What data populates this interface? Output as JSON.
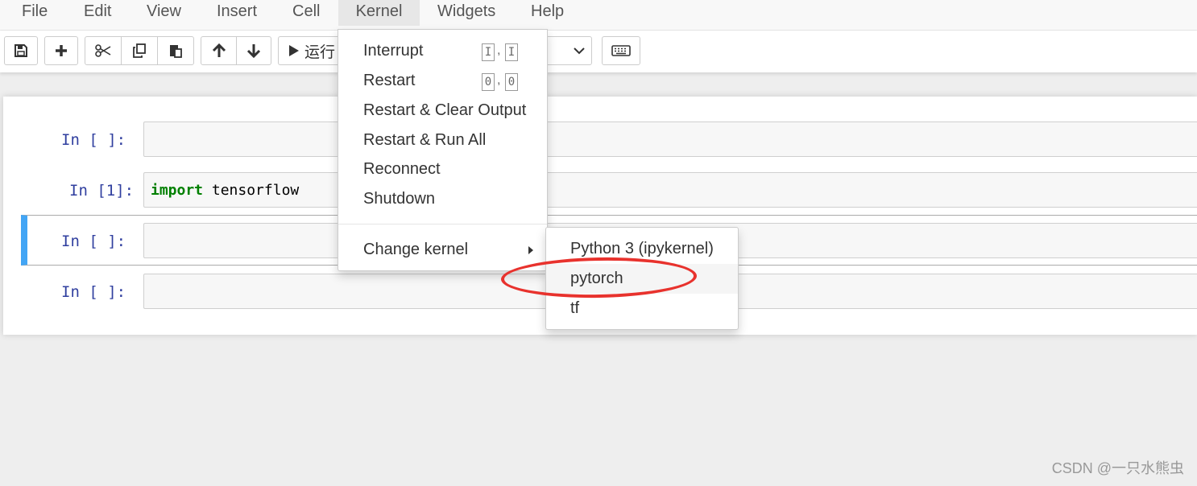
{
  "menubar": {
    "items": [
      "File",
      "Edit",
      "View",
      "Insert",
      "Cell",
      "Kernel",
      "Widgets",
      "Help"
    ],
    "active": "Kernel"
  },
  "toolbar": {
    "run_label": "运行",
    "icons": [
      "save-icon",
      "plus-icon",
      "scissors-icon",
      "copy-icon",
      "paste-icon",
      "arrow-up-icon",
      "arrow-down-icon",
      "play-icon",
      "keyboard-icon"
    ]
  },
  "cells": [
    {
      "prompt": "In [ ]:",
      "code": ""
    },
    {
      "prompt": "In [1]:",
      "code_keyword": "import",
      "code_rest": " tensorflow"
    },
    {
      "prompt": "In [ ]:",
      "code": "",
      "selected": true
    },
    {
      "prompt": "In [ ]:",
      "code": ""
    }
  ],
  "kernel_menu": {
    "items": [
      {
        "label": "Interrupt",
        "shortcut": [
          "I",
          "I"
        ]
      },
      {
        "label": "Restart",
        "shortcut": [
          "0",
          "0"
        ]
      },
      {
        "label": "Restart & Clear Output"
      },
      {
        "label": "Restart & Run All"
      },
      {
        "label": "Reconnect"
      },
      {
        "label": "Shutdown"
      }
    ],
    "change_kernel": "Change kernel"
  },
  "change_kernel_submenu": {
    "items": [
      "Python 3 (ipykernel)",
      "pytorch",
      "tf"
    ],
    "highlighted": "pytorch"
  },
  "annotation_color": "#e8322d",
  "accent_color": "#42a5f5",
  "watermark": "CSDN @一只水熊虫"
}
